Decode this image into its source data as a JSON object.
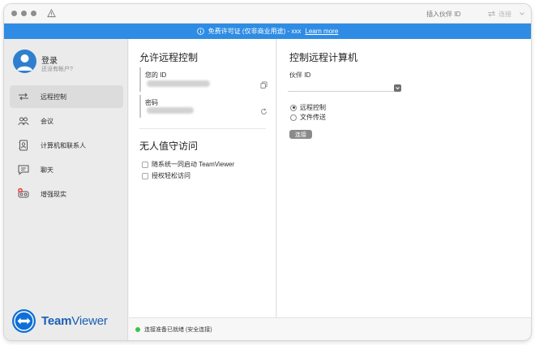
{
  "titlebar": {
    "partner_id_placeholder": "插入伙伴 ID",
    "connect_label": "连接"
  },
  "banner": {
    "text": "免费许可证 (仅非商业用途) - xxx",
    "link": "Learn more",
    "color": "#2f8ce4"
  },
  "sidebar": {
    "user": {
      "title": "登录",
      "subtitle": "还没有帐户?"
    },
    "items": [
      {
        "label": "远程控制",
        "icon": "remote-control-icon",
        "active": true
      },
      {
        "label": "会议",
        "icon": "meeting-icon",
        "active": false
      },
      {
        "label": "计算机和联系人",
        "icon": "contacts-icon",
        "active": false
      },
      {
        "label": "聊天",
        "icon": "chat-icon",
        "active": false
      },
      {
        "label": "增强现实",
        "icon": "augmented-reality-icon",
        "active": false
      }
    ],
    "brand": {
      "name_bold": "Team",
      "name_light": "Viewer",
      "color": "#0e6fd6"
    }
  },
  "allow_remote": {
    "title": "允许远程控制",
    "your_id_label": "您的 ID",
    "password_label": "密码"
  },
  "unattended": {
    "title": "无人值守访问",
    "options": [
      {
        "label": "随系统一同启动 TeamViewer",
        "checked": false
      },
      {
        "label": "授权轻松访问",
        "checked": false
      }
    ]
  },
  "control_remote": {
    "title": "控制远程计算机",
    "partner_id_label": "伙伴 ID",
    "partner_id_value": "",
    "modes": [
      {
        "label": "远程控制",
        "selected": true
      },
      {
        "label": "文件传送",
        "selected": false
      }
    ],
    "connect_button": "连接"
  },
  "status": {
    "text": "连接准备已就绪 (安全连接)",
    "color": "#3cc24a"
  }
}
